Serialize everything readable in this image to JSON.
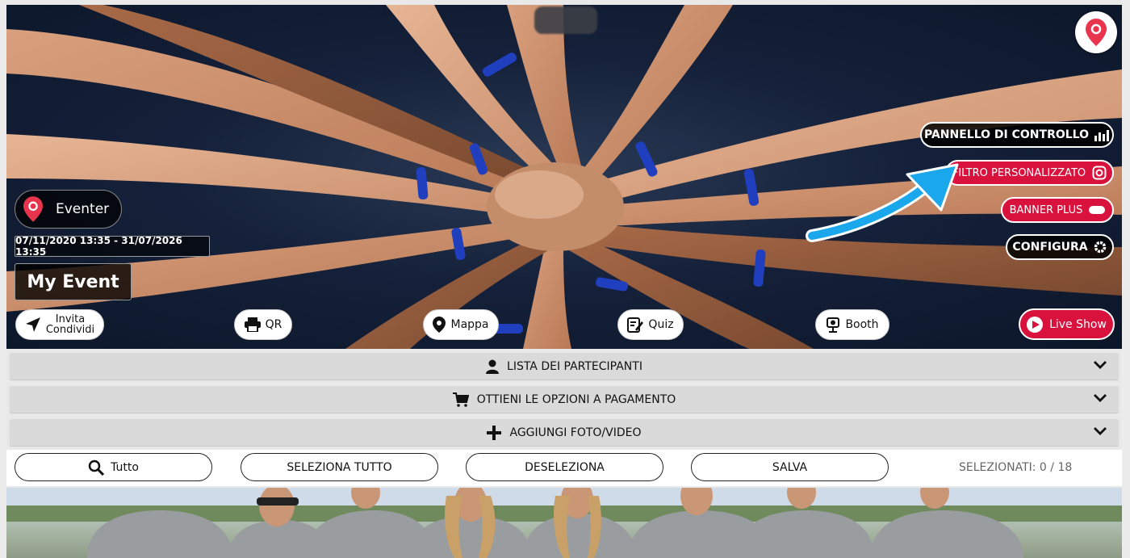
{
  "header": {
    "brand_name": "Eventer",
    "date_range": "07/11/2020 13:35 - 31/07/2026 13:35",
    "event_title": "My Event"
  },
  "side_menu": {
    "control_panel": "PANNELLO DI CONTROLLO",
    "custom_filter": "FILTRO PERSONALIZZATO",
    "banner_plus": "BANNER PLUS",
    "configure": "CONFIGURA"
  },
  "actions": {
    "invite_line1": "Invita",
    "invite_line2": "Condividi",
    "qr": "QR",
    "map": "Mappa",
    "quiz": "Quiz",
    "booth": "Booth",
    "live_show": "Live Show"
  },
  "accordions": [
    {
      "label": "LISTA DEI PARTECIPANTI",
      "icon": "user-icon"
    },
    {
      "label": "OTTIENI LE OPZIONI A PAGAMENTO",
      "icon": "cart-icon"
    },
    {
      "label": "AGGIUNGI FOTO/VIDEO",
      "icon": "plus-icon"
    }
  ],
  "toolbar": {
    "filter_label": "Tutto",
    "select_all": "SELEZIONA TUTTO",
    "deselect": "DESELEZIONA",
    "save": "SALVA",
    "selected_count": "SELEZIONATI: 0 / 18"
  },
  "colors": {
    "accent_red": "#d8123c",
    "arrow_blue": "#1aa7ec"
  }
}
